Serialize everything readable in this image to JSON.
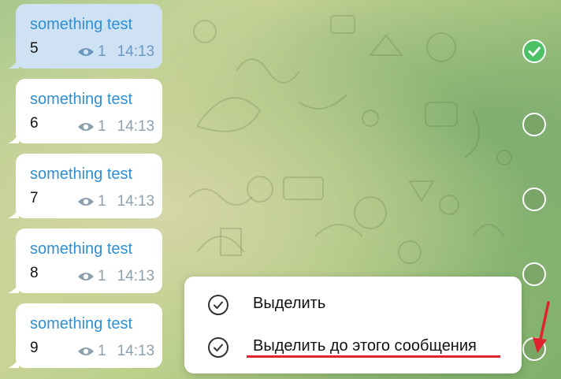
{
  "messages": [
    {
      "title": "something test",
      "body": "5",
      "views": "1",
      "time": "14:13",
      "selected": true
    },
    {
      "title": "something test",
      "body": "6",
      "views": "1",
      "time": "14:13",
      "selected": false
    },
    {
      "title": "something test",
      "body": "7",
      "views": "1",
      "time": "14:13",
      "selected": false
    },
    {
      "title": "something test",
      "body": "8",
      "views": "1",
      "time": "14:13",
      "selected": false
    },
    {
      "title": "something test",
      "body": "9",
      "views": "1",
      "time": "14:13",
      "selected": false
    }
  ],
  "context_menu": {
    "items": [
      {
        "label": "Выделить",
        "icon": "check-circle-icon"
      },
      {
        "label": "Выделить до этого сообщения",
        "icon": "check-circle-icon"
      }
    ]
  },
  "colors": {
    "title": "#2f8fd2",
    "selected_bubble": "#cfe2f3",
    "check_green": "#4cc064",
    "annotation_red": "#e0232c"
  }
}
